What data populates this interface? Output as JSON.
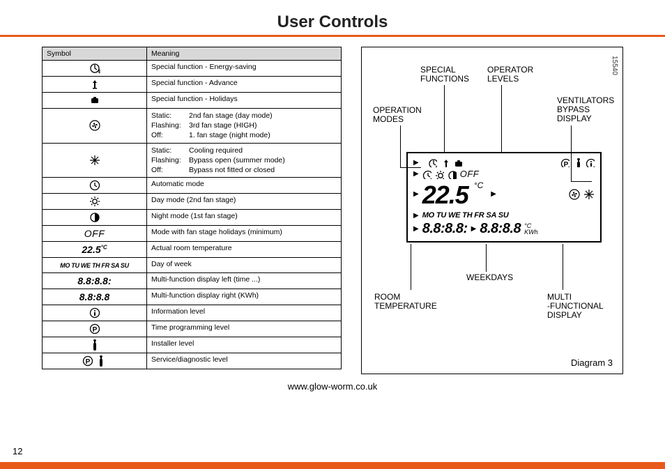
{
  "page_title": "User Controls",
  "table": {
    "headers": {
      "symbol": "Symbol",
      "meaning": "Meaning"
    },
    "rows": [
      {
        "icon": "energy",
        "meaning": "Special function - Energy-saving"
      },
      {
        "icon": "advance",
        "meaning": "Special function - Advance"
      },
      {
        "icon": "holiday",
        "meaning": "Special function - Holidays"
      },
      {
        "icon": "fan",
        "meaning_multi": [
          [
            "Static:",
            "2nd fan stage (day mode)"
          ],
          [
            "Flashing:",
            "3rd fan stage (HIGH)"
          ],
          [
            "Off:",
            "1. fan stage (night mode)"
          ]
        ]
      },
      {
        "icon": "snow",
        "meaning_multi": [
          [
            "Static:",
            "Cooling required"
          ],
          [
            "Flashing:",
            "Bypass open (summer mode)"
          ],
          [
            "Off:",
            "Bypass not fitted or closed"
          ]
        ]
      },
      {
        "icon": "clock",
        "meaning": "Automatic mode"
      },
      {
        "icon": "sun",
        "meaning": "Day mode (2nd fan stage)"
      },
      {
        "icon": "moon",
        "meaning": "Night mode (1st fan stage)"
      },
      {
        "icon": "off",
        "text": "OFF",
        "meaning": "Mode with fan stage holidays (minimum)"
      },
      {
        "icon": "temp",
        "text": "22.5",
        "unit": "°C",
        "meaning": "Actual room temperature"
      },
      {
        "icon": "days",
        "text": "MO TU WE TH FR SA SU",
        "meaning": "Day of week"
      },
      {
        "icon": "segL",
        "text": "8.8:8.8:",
        "meaning": "Multi-function display left (time ...)"
      },
      {
        "icon": "segR",
        "text": "8.8:8.8",
        "meaning": "Multi-function display right (KWh)"
      },
      {
        "icon": "info",
        "meaning": "Information level"
      },
      {
        "icon": "prog",
        "meaning": "Time programming level"
      },
      {
        "icon": "installer",
        "meaning": "Installer level"
      },
      {
        "icon": "service",
        "meaning": "Service/diagnostic level"
      }
    ]
  },
  "diagram": {
    "id": "15540",
    "caption": "Diagram 3",
    "labels": {
      "special_functions": "SPECIAL\nFUNCTIONS",
      "operator_levels": "OPERATOR\nLEVELS",
      "operation_modes": "OPERATION\nMODES",
      "ventilators": "VENTILATORS\nBYPASS\nDISPLAY",
      "room_temp": "ROOM\nTEMPERATURE",
      "weekdays": "WEEKDAYS",
      "multi_display": "MULTI\n-FUNCTIONAL\nDISPLAY"
    },
    "lcd": {
      "off": "OFF",
      "temperature": "22.5",
      "temp_unit": "°C",
      "days": "MO TU WE TH FR SA SU",
      "seg_left": "8.8:8.8:",
      "seg_right": "8.8:8.8",
      "seg_right_unit": "°C\nKWh"
    }
  },
  "footer_url": "www.glow-worm.co.uk",
  "page_number": "12"
}
